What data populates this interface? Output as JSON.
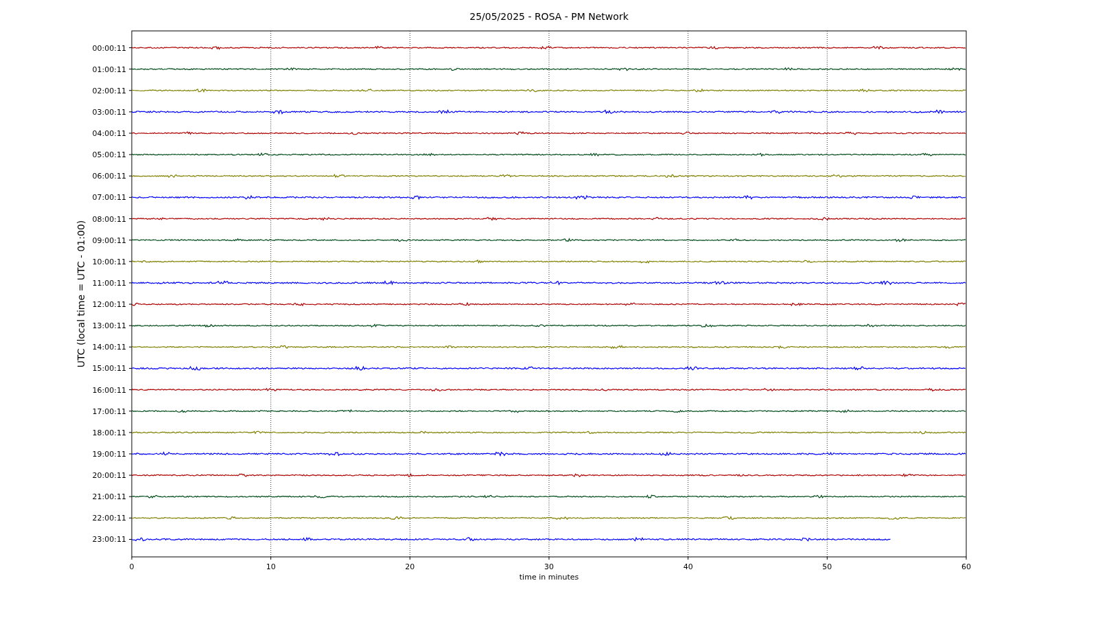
{
  "title": "25/05/2025 - ROSA - PM Network",
  "ylabel": "UTC (local time = UTC - 01:00)",
  "xlabel": "time in minutes",
  "xticks": [
    "0",
    "10",
    "20",
    "30",
    "40",
    "50",
    "60"
  ],
  "rows": [
    {
      "label": "00:00:11",
      "color": "#b00000",
      "level": 1
    },
    {
      "label": "01:00:11",
      "color": "#004d1a",
      "level": 1
    },
    {
      "label": "02:00:11",
      "color": "#808000",
      "level": 1
    },
    {
      "label": "03:00:11",
      "color": "#0000ff",
      "level": 1
    },
    {
      "label": "04:00:11",
      "color": "#b00000",
      "level": 1
    },
    {
      "label": "05:00:11",
      "color": "#004d1a",
      "level": 1
    },
    {
      "label": "06:00:11",
      "color": "#808000",
      "level": 1
    },
    {
      "label": "07:00:11",
      "color": "#0000ff",
      "level": 1
    },
    {
      "label": "08:00:11",
      "color": "#b00000",
      "level": 1
    },
    {
      "label": "09:00:11",
      "color": "#004d1a",
      "level": 1
    },
    {
      "label": "10:00:11",
      "color": "#808000",
      "level": 1
    },
    {
      "label": "11:00:11",
      "color": "#0000ff",
      "level": 1
    },
    {
      "label": "12:00:11",
      "color": "#b00000",
      "level": 1
    },
    {
      "label": "13:00:11",
      "color": "#004d1a",
      "level": 1
    },
    {
      "label": "14:00:11",
      "color": "#808000",
      "level": 1
    },
    {
      "label": "15:00:11",
      "color": "#0000ff",
      "level": 1
    },
    {
      "label": "16:00:11",
      "color": "#b00000",
      "level": 1
    },
    {
      "label": "17:00:11",
      "color": "#004d1a",
      "level": 1
    },
    {
      "label": "18:00:11",
      "color": "#808000",
      "level": 1
    },
    {
      "label": "19:00:11",
      "color": "#0000ff",
      "level": 1
    },
    {
      "label": "20:00:11",
      "color": "#b00000",
      "level": 1
    },
    {
      "label": "21:00:11",
      "color": "#004d1a",
      "level": 1
    },
    {
      "label": "22:00:11",
      "color": "#808000",
      "level": 1
    },
    {
      "label": "23:00:11",
      "color": "#0000ff",
      "level": 0.91
    }
  ]
}
